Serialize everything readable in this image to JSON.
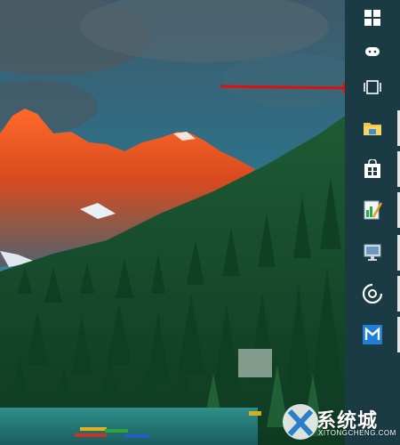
{
  "taskbar": {
    "items": [
      {
        "name": "start-button",
        "icon": "windows-logo-icon"
      },
      {
        "name": "cortana-button",
        "icon": "cortana-icon"
      },
      {
        "name": "task-view-button",
        "icon": "task-view-icon"
      },
      {
        "name": "file-explorer-button",
        "icon": "folder-icon"
      },
      {
        "name": "store-button",
        "icon": "store-icon"
      },
      {
        "name": "notepad-app-button",
        "icon": "notepad-icon"
      },
      {
        "name": "remote-desktop-button",
        "icon": "monitor-icon"
      },
      {
        "name": "media-player-button",
        "icon": "disc-icon"
      },
      {
        "name": "app-button",
        "icon": "blue-app-icon"
      }
    ],
    "background_color": "#1a3b44",
    "active_indicator_color": "#e6e6e6"
  },
  "annotation": {
    "type": "red-arrow",
    "color": "#e01010",
    "points_to": "task-view-button"
  },
  "watermark": {
    "main_text": "系统城",
    "sub_text": "XITONGCHENG.COM"
  }
}
